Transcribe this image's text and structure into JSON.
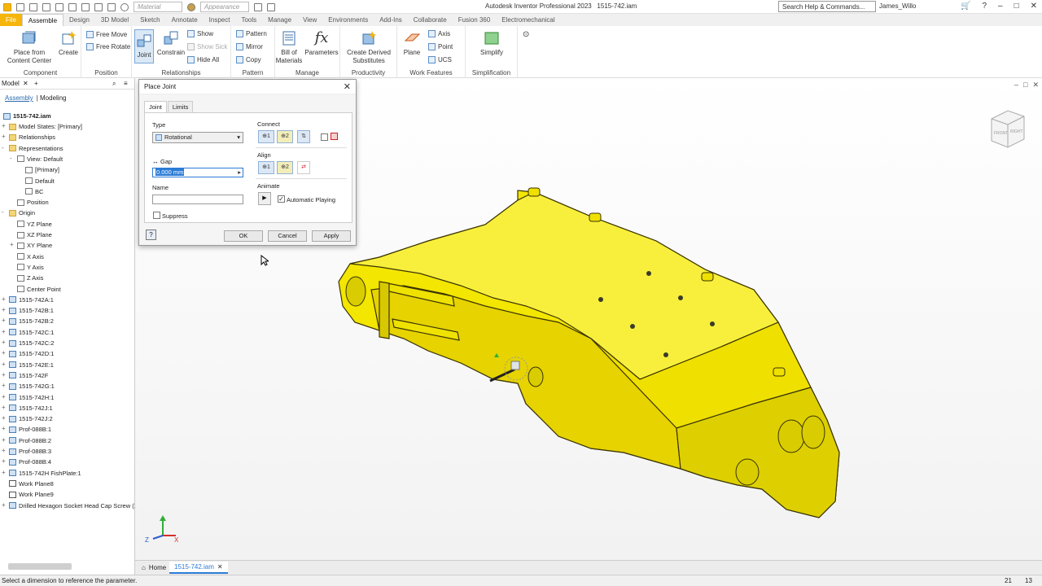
{
  "app": {
    "title": "Autodesk Inventor Professional 2023",
    "document": "1515-742.iam",
    "search_placeholder": "Search Help & Commands...",
    "user": "James_Willo",
    "material_combo": "Material",
    "appearance_combo": "Appearance"
  },
  "ribbon_tabs": [
    "File",
    "Assemble",
    "Design",
    "3D Model",
    "Sketch",
    "Annotate",
    "Inspect",
    "Tools",
    "Manage",
    "View",
    "Environments",
    "Add-Ins",
    "Collaborate",
    "Fusion 360",
    "Electromechanical"
  ],
  "ribbon": {
    "place_from_content_center": "Place from\nContent Center",
    "create": "Create",
    "free_move": "Free Move",
    "free_rotate": "Free Rotate",
    "joint": "Joint",
    "constrain": "Constrain",
    "show": "Show",
    "show_sick": "Show Sick",
    "hide_all": "Hide All",
    "pattern": "Pattern",
    "mirror": "Mirror",
    "copy": "Copy",
    "bill_of_materials": "Bill of\nMaterials",
    "parameters": "Parameters",
    "create_derived_substitutes": "Create Derived\nSubstitutes",
    "plane": "Plane",
    "axis": "Axis",
    "point": "Point",
    "ucs": "UCS",
    "simplify": "Simplify",
    "groups": [
      "Component",
      "Position",
      "Relationships",
      "Pattern",
      "Manage",
      "Productivity",
      "Work Features",
      "Simplification"
    ]
  },
  "browser": {
    "title": "Model",
    "tab_assembly": "Assembly",
    "tab_modeling": "Modeling",
    "root": "1515-742.iam",
    "nodes": [
      "Model States: [Primary]",
      "Relationships",
      "Representations",
      "View: Default",
      "[Primary]",
      "Default",
      "BC",
      "Position",
      "Origin",
      "YZ Plane",
      "XZ Plane",
      "XY Plane",
      "X Axis",
      "Y Axis",
      "Z Axis",
      "Center Point",
      "1515-742A:1",
      "1515-742B:1",
      "1515-742B:2",
      "1515-742C:1",
      "1515-742C:2",
      "1515-742D:1",
      "1515-742E:1",
      "1515-742F",
      "1515-742G:1",
      "1515-742H:1",
      "1515-742J:1",
      "1515-742J:2",
      "Prof-088B:1",
      "Prof-088B:2",
      "Prof-088B:3",
      "Prof-088B:4",
      "1515-742H FishPlate:1",
      "Work Plane8",
      "Work Plane9",
      "Drilled Hexagon Socket Head Cap Screw (19"
    ]
  },
  "dialog": {
    "title": "Place Joint",
    "tab_joint": "Joint",
    "tab_limits": "Limits",
    "type_label": "Type",
    "type_value": "Rotational",
    "gap_label": "Gap",
    "gap_value": "0.000 mm",
    "name_label": "Name",
    "name_value": "",
    "suppress_label": "Suppress",
    "connect_label": "Connect",
    "align_label": "Align",
    "animate_label": "Animate",
    "automatic_playing": "Automatic Playing",
    "ok": "OK",
    "cancel": "Cancel",
    "apply": "Apply",
    "connect_1": "1",
    "connect_2": "2",
    "align_1": "1",
    "align_2": "2"
  },
  "viewcube": {
    "front": "FRONT",
    "right": "RIGHT"
  },
  "doc_tabs": {
    "home": "Home",
    "current": "1515-742.iam"
  },
  "status": {
    "message": "Select a dimension to reference the parameter.",
    "n1": "21",
    "n2": "13"
  },
  "colors": {
    "part_yellow": "#f3e600",
    "accent": "#f5b50a",
    "selection_blue": "#2b7bd6"
  }
}
